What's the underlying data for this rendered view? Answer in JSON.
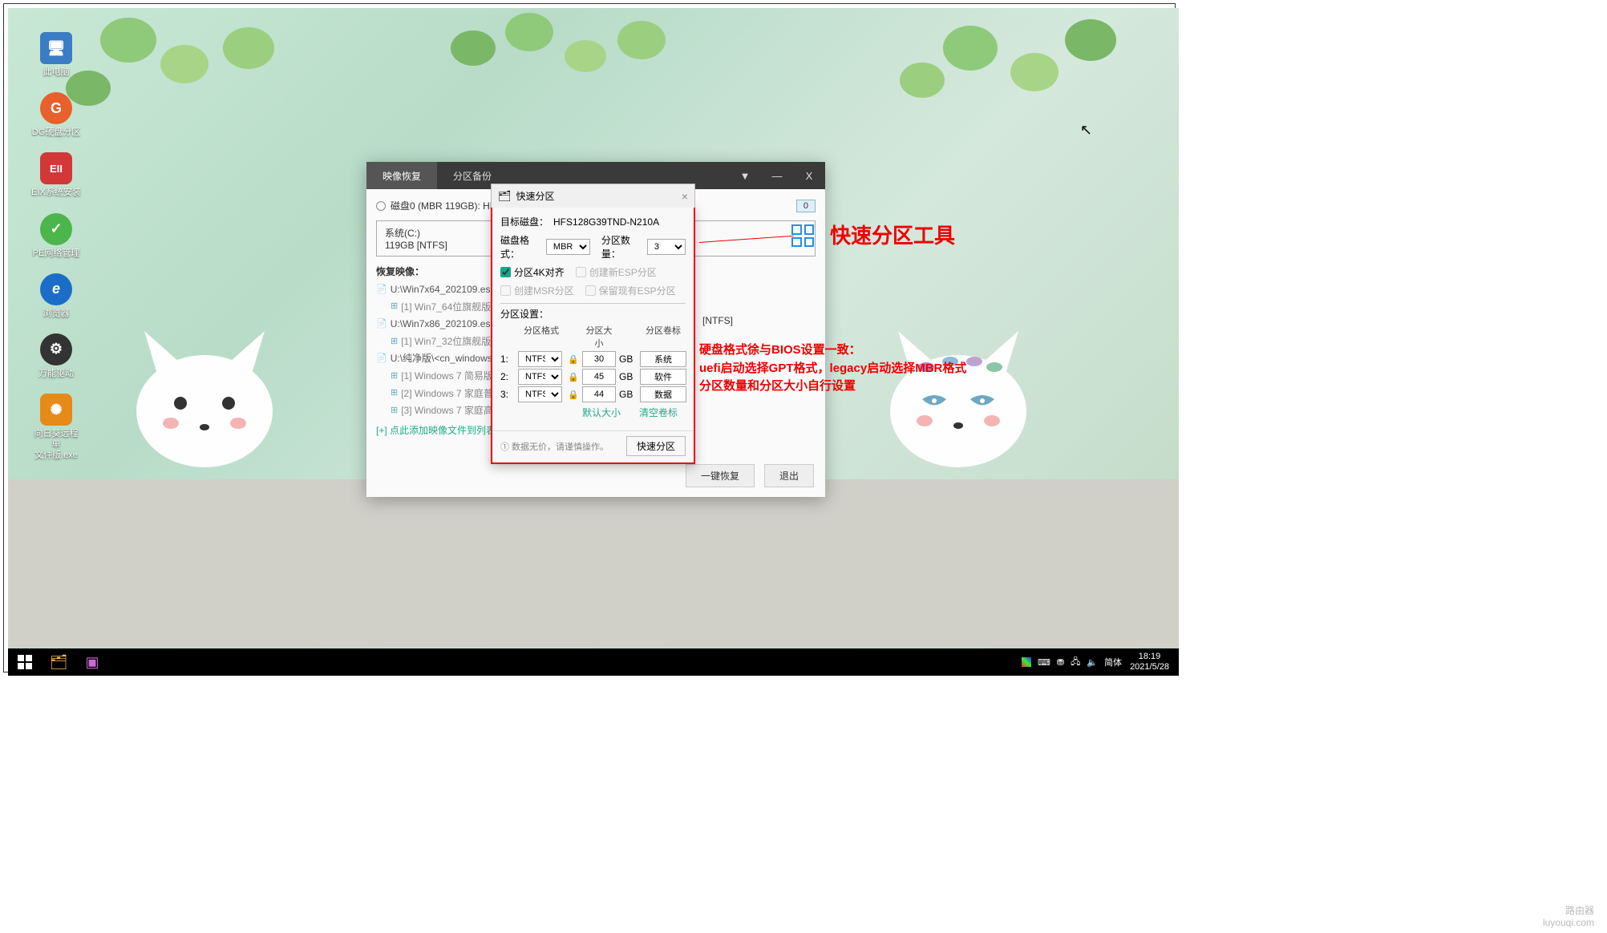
{
  "desktop_icons": [
    {
      "label": "此电脑",
      "color": "#3a7dc4",
      "glyph": "🖥"
    },
    {
      "label": "DG硬盘分区",
      "color": "#e8602c",
      "glyph": "G"
    },
    {
      "label": "EIX系统安装",
      "color": "#d23838",
      "glyph": "EII"
    },
    {
      "label": "PE网络管理",
      "color": "#4cb54c",
      "glyph": "✓"
    },
    {
      "label": "浏览器",
      "color": "#1a6ec8",
      "glyph": "e"
    },
    {
      "label": "万能驱动",
      "color": "#333",
      "glyph": "⚙"
    },
    {
      "label": "向日葵远程单\n文件版.exe",
      "color": "#e68a1a",
      "glyph": "✺"
    }
  ],
  "taskbar": {
    "time": "18:19",
    "date": "2021/5/28"
  },
  "app": {
    "tabs": [
      "映像恢复",
      "分区备份"
    ],
    "disk_line": "磁盘0 (MBR 119GB): HFS128G39TND-N210A",
    "disk_index": "0",
    "partition": {
      "name": "系统(C:)",
      "info": "119GB [NTFS]"
    },
    "restore_label": "恢复映像：",
    "tree": [
      {
        "file": "U:\\Win7x64_202109.esd",
        "sub": "[1] Win7_64位旗舰版"
      },
      {
        "file": "U:\\Win7x86_202109.esd",
        "sub": "[1] Win7_32位旗舰版"
      },
      {
        "file": "U:\\纯净版\\<cn_windows_",
        "subs": [
          "[1] Windows 7 简易版",
          "[2] Windows 7 家庭普",
          "[3] Windows 7 家庭高"
        ]
      }
    ],
    "add_link": "[+] 点此添加映像文件到列表",
    "buttons": {
      "ok": "一键恢复",
      "cancel": "退出"
    },
    "ntfs_hint": "[NTFS]"
  },
  "dialog": {
    "title": "快速分区",
    "target_label": "目标磁盘：",
    "target_disk": "HFS128G39TND-N210A",
    "format_label": "磁盘格式：",
    "format_value": "MBR",
    "count_label": "分区数量：",
    "count_value": "3",
    "check_4k": "分区4K对齐",
    "check_esp": "创建新ESP分区",
    "check_msr": "创建MSR分区",
    "check_keep_esp": "保留现有ESP分区",
    "section_label": "分区设置：",
    "headers": {
      "fmt": "分区格式",
      "size": "分区大小",
      "vol": "分区卷标"
    },
    "rows": [
      {
        "n": "1:",
        "fmt": "NTFS",
        "size": "30",
        "unit": "GB",
        "vol": "系统"
      },
      {
        "n": "2:",
        "fmt": "NTFS",
        "size": "45",
        "unit": "GB",
        "vol": "软件"
      },
      {
        "n": "3:",
        "fmt": "NTFS",
        "size": "44",
        "unit": "GB",
        "vol": "数据"
      }
    ],
    "default_size": "默认大小",
    "clear_vol": "清空卷标",
    "warn": "① 数据无价，请谨慎操作。",
    "quick_btn": "快速分区"
  },
  "annotations": {
    "title": "快速分区工具",
    "text": "硬盘格式徐与BIOS设置一致：\nuefi启动选择GPT格式，legacy启动选择MBR格式\n分区数量和分区大小自行设置"
  },
  "watermark": "路由器\nluyouqi.com"
}
